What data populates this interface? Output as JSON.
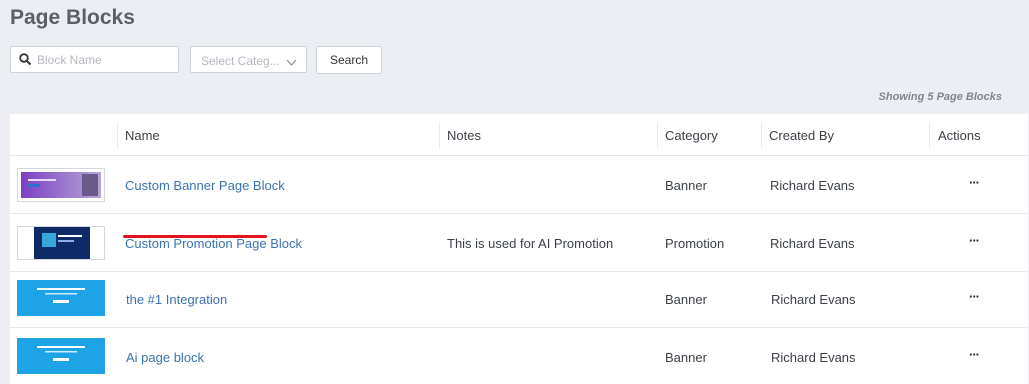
{
  "page_title": "Page Blocks",
  "search": {
    "placeholder": "Block Name",
    "icon": "search-icon"
  },
  "category_select": {
    "placeholder": "Select Categ..."
  },
  "search_button": "Search",
  "count_text": "Showing 5 Page Blocks",
  "columns": [
    "Name",
    "Notes",
    "Category",
    "Created By",
    "Actions"
  ],
  "rows": [
    {
      "name": "Custom Banner Page Block",
      "notes": "",
      "category": "Banner",
      "created_by": "Richard Evans",
      "actions": "···",
      "thumb": "purple-banner"
    },
    {
      "name": "Custom Promotion Page Block",
      "notes": "This is used for AI Promotion",
      "category": "Promotion",
      "created_by": "Richard Evans",
      "actions": "···",
      "thumb": "navy-promo"
    },
    {
      "name": "the #1 Integration",
      "notes": "",
      "category": "Banner",
      "created_by": "Richard Evans",
      "actions": "···",
      "thumb": "blue-banner"
    },
    {
      "name": "Ai page block",
      "notes": "",
      "category": "Banner",
      "created_by": "Richard Evans",
      "actions": "···",
      "thumb": "blue-banner"
    }
  ],
  "colors": {
    "link": "#3b73b0",
    "highlight": "#e3121b",
    "background": "#eceef3"
  }
}
